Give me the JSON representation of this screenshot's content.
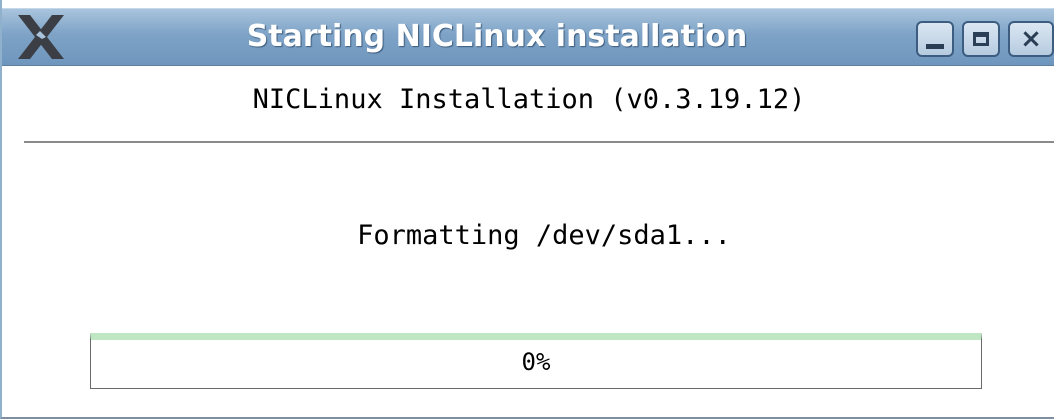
{
  "window": {
    "title": "Starting NICLinux installation",
    "controls": {
      "minimize_icon": "minimize-icon",
      "maximize_icon": "maximize-icon",
      "close_icon": "close-icon"
    },
    "app_icon": "x-logo-icon"
  },
  "main": {
    "heading": "NICLinux Installation (v0.3.19.12)",
    "status": "Formatting /dev/sda1...",
    "progress": {
      "value": 0,
      "label": "0%"
    }
  },
  "colors": {
    "titlebar": "#7ea3c7",
    "title_text": "#ffffff",
    "progress_accent": "#bfe7c4",
    "divider": "#8a8a8a"
  }
}
